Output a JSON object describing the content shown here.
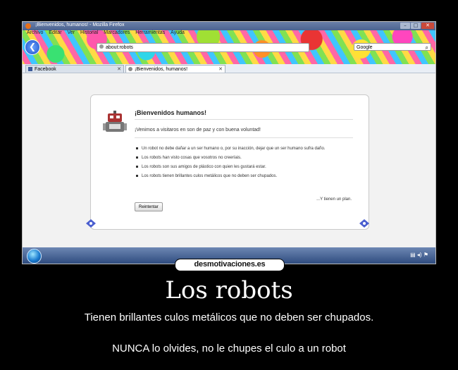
{
  "browser": {
    "window_title": "¡Bienvenidos, humanos! - Mozilla Firefox",
    "menu": [
      "Archivo",
      "Editar",
      "Ver",
      "Historial",
      "Marcadores",
      "Herramientas",
      "Ayuda"
    ],
    "url": "about:robots",
    "search_placeholder": "Google",
    "tabs": [
      {
        "label": "Facebook",
        "active": false
      },
      {
        "label": "¡Bienvenidos, humanos!",
        "active": true
      }
    ]
  },
  "page": {
    "title": "¡Bienvenidos humanos!",
    "subtitle": "¡Venimos a visitaros en son de paz y con buena voluntad!",
    "laws": [
      "Un robot no debe dañar a un ser humano o, por su inacción, dejar que un ser humano sufra daño.",
      "Los robots han visto cosas que vosotros no creeríais.",
      "Los robots son sus amigos de plástico con quien les gustará estar.",
      "Los robots tienen brillantes culos metálicos que no deben ser chupados."
    ],
    "plan_text": "...Y tienen un plan.",
    "retry_label": "Reintentar"
  },
  "poster": {
    "site_logo": "desmotivaciones.es",
    "title": "Los robots",
    "line1": "Tienen brillantes culos metálicos que no deben ser chupados.",
    "line2": "NUNCA lo olvides, no le chupes el culo a un robot"
  },
  "colors": {
    "background": "#000000",
    "taskbar": "#3a5a8f",
    "firefox_orange": "#e8701a"
  }
}
